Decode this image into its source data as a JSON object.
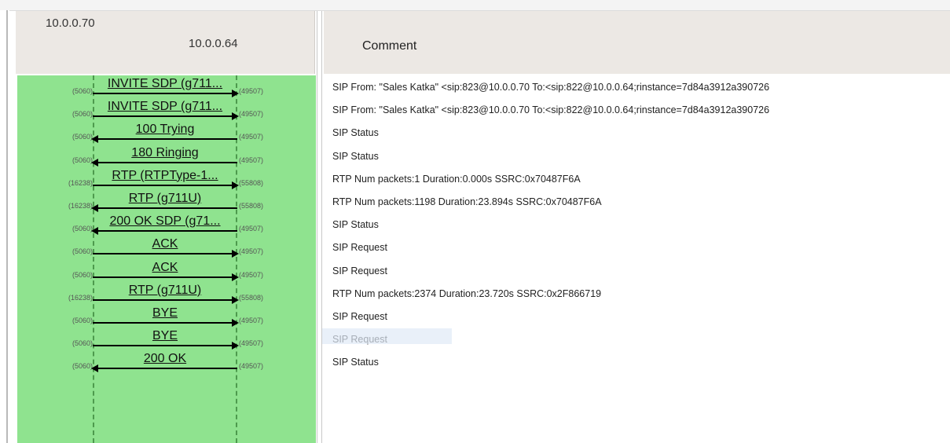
{
  "header": {
    "host_a": "10.0.0.70",
    "host_b": "10.0.0.64",
    "comment_title": "Comment"
  },
  "rows": [
    {
      "label": "INVITE SDP (g711...",
      "direction": "right",
      "port_left": "(5060)",
      "port_right": "(49507)",
      "comment": "SIP From: \"Sales Katka\" <sip:823@10.0.0.70 To:<sip:822@10.0.0.64;rinstance=7d84a3912a390726"
    },
    {
      "label": "INVITE SDP (g711...",
      "direction": "right",
      "port_left": "(5060)",
      "port_right": "(49507)",
      "comment": "SIP From: \"Sales Katka\" <sip:823@10.0.0.70 To:<sip:822@10.0.0.64;rinstance=7d84a3912a390726"
    },
    {
      "label": "100 Trying",
      "direction": "left",
      "port_left": "(5060)",
      "port_right": "(49507)",
      "comment": "SIP Status"
    },
    {
      "label": "180 Ringing",
      "direction": "left",
      "port_left": "(5060)",
      "port_right": "(49507)",
      "comment": "SIP Status"
    },
    {
      "label": "RTP (RTPType-1...",
      "direction": "right",
      "port_left": "(16238)",
      "port_right": "(55808)",
      "comment": "RTP Num packets:1  Duration:0.000s SSRC:0x70487F6A"
    },
    {
      "label": "RTP (g711U)",
      "direction": "left",
      "port_left": "(16238)",
      "port_right": "(55808)",
      "comment": "RTP Num packets:1198  Duration:23.894s SSRC:0x70487F6A"
    },
    {
      "label": "200 OK SDP (g71...",
      "direction": "left",
      "port_left": "(5060)",
      "port_right": "(49507)",
      "comment": "SIP Status"
    },
    {
      "label": "ACK",
      "direction": "right",
      "port_left": "(5060)",
      "port_right": "(49507)",
      "comment": "SIP Request"
    },
    {
      "label": "ACK",
      "direction": "right",
      "port_left": "(5060)",
      "port_right": "(49507)",
      "comment": "SIP Request"
    },
    {
      "label": "RTP (g711U)",
      "direction": "right",
      "port_left": "(16238)",
      "port_right": "(55808)",
      "comment": "RTP Num packets:2374  Duration:23.720s SSRC:0x2F866719"
    },
    {
      "label": "BYE",
      "direction": "right",
      "port_left": "(5060)",
      "port_right": "(49507)",
      "comment": "SIP Request"
    },
    {
      "label": "BYE",
      "direction": "right",
      "port_left": "(5060)",
      "port_right": "(49507)",
      "comment": "SIP Request"
    },
    {
      "label": "200 OK",
      "direction": "left",
      "port_left": "(5060)",
      "port_right": "(49507)",
      "comment": "SIP Status"
    }
  ]
}
